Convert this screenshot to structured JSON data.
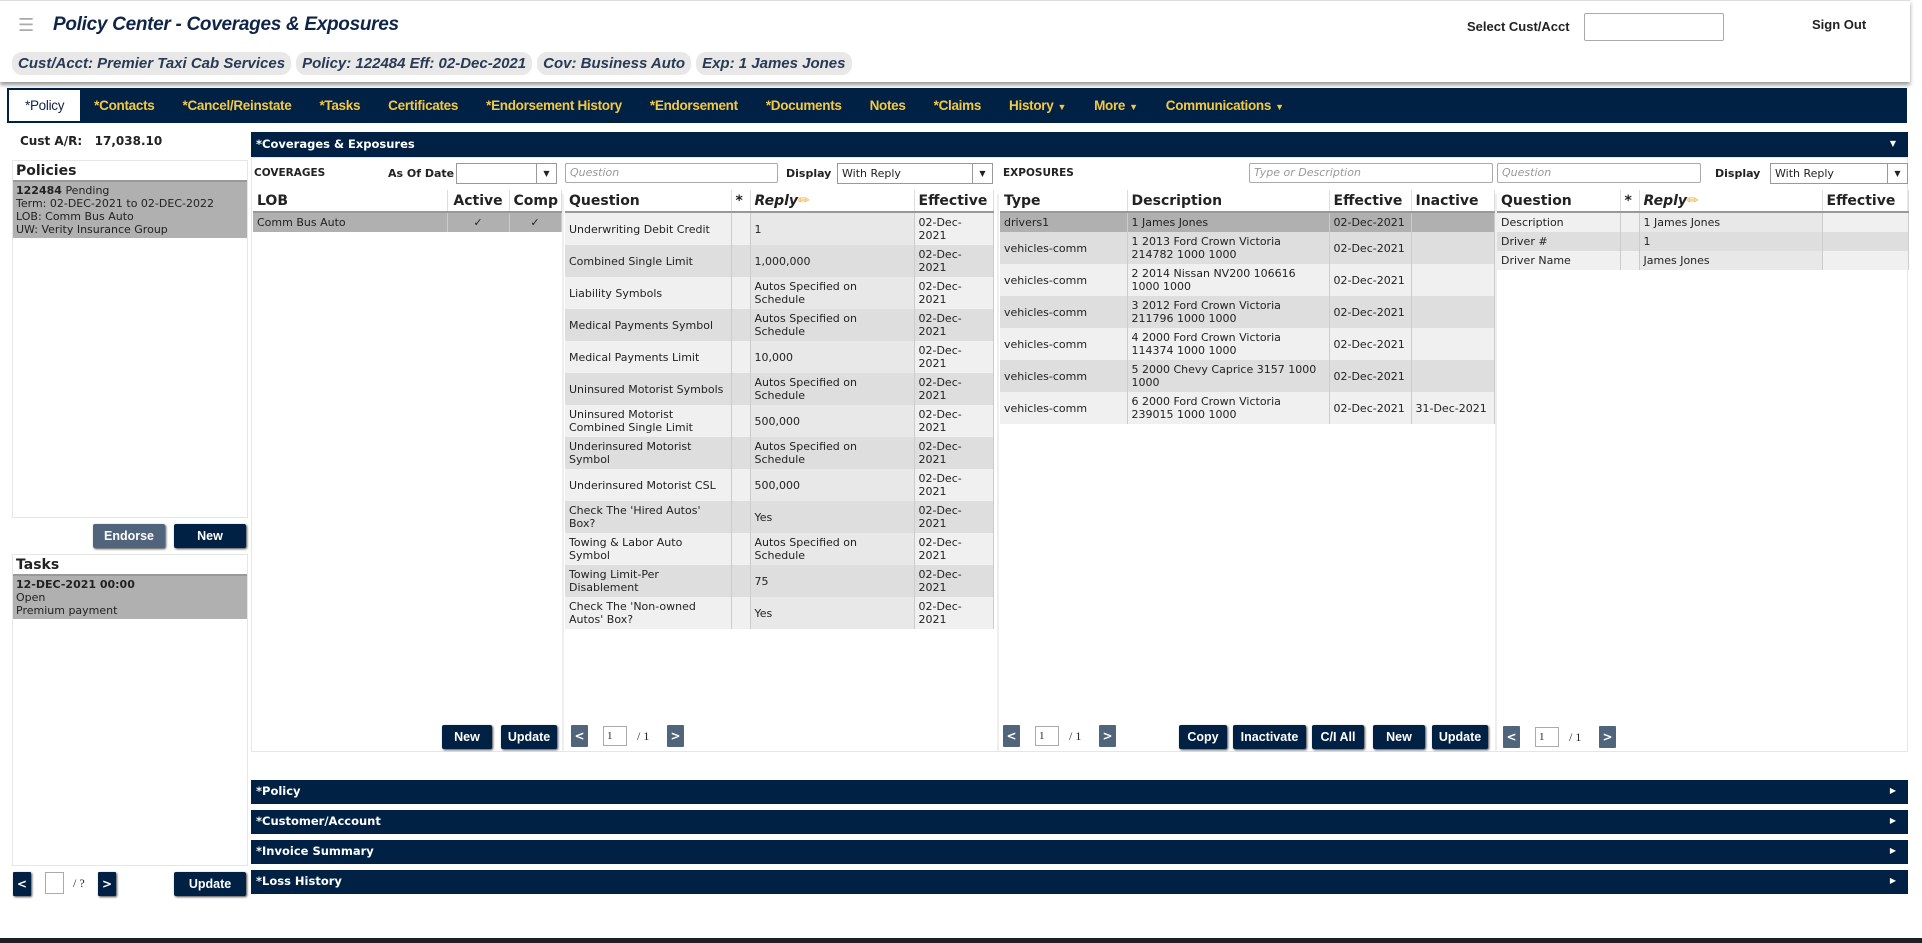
{
  "header": {
    "title": "Policy Center - Coverages & Exposures",
    "pills": [
      "Cust/Acct: Premier Taxi Cab Services",
      "Policy: 122484 Eff: 02-Dec-2021",
      "Cov: Business Auto",
      "Exp: 1 James Jones"
    ],
    "select_label": "Select Cust/Acct",
    "select_value": "",
    "sign_out": "Sign Out"
  },
  "nav": [
    {
      "label": "*Policy",
      "active": true
    },
    {
      "label": "*Contacts"
    },
    {
      "label": "*Cancel/Reinstate"
    },
    {
      "label": "*Tasks"
    },
    {
      "label": "Certificates"
    },
    {
      "label": "*Endorsement History"
    },
    {
      "label": "*Endorsement"
    },
    {
      "label": "*Documents"
    },
    {
      "label": "Notes"
    },
    {
      "label": "*Claims"
    },
    {
      "label": "History",
      "dropdown": true
    },
    {
      "label": "More",
      "dropdown": true
    },
    {
      "label": "Communications",
      "dropdown": true
    }
  ],
  "sidebar": {
    "ar_label": "Cust A/R:",
    "ar_value": "17,038.10",
    "policies": {
      "title": "Policies",
      "item": {
        "number": "122484",
        "status": "Pending",
        "term": "Term: 02-DEC-2021 to 02-DEC-2022",
        "lob": "LOB: Comm Bus Auto",
        "uw": "UW: Verity Insurance Group"
      },
      "endorse": "Endorse",
      "new": "New"
    },
    "tasks": {
      "title": "Tasks",
      "item": {
        "date": "12-DEC-2021 00:00",
        "status": "Open",
        "desc": "Premium payment"
      }
    },
    "pager": {
      "page": "",
      "total": "/ ?",
      "prev": "<",
      "next": ">"
    },
    "update": "Update"
  },
  "main": {
    "title": "*Coverages & Exposures",
    "coverages": {
      "label": "COVERAGES",
      "as_of_label": "As Of Date",
      "as_of_value": "",
      "question_placeholder": "Question",
      "display_label": "Display",
      "display_value": "With Reply",
      "lob_headers": [
        "LOB",
        "Active",
        "Comp"
      ],
      "lob_rows": [
        [
          "Comm Bus Auto",
          "✓",
          "✓"
        ]
      ],
      "q_headers": [
        "Question",
        "*",
        "Reply",
        "Effective"
      ],
      "q_rows": [
        [
          "Underwriting Debit Credit",
          "",
          "1",
          "02-Dec-2021"
        ],
        [
          "Combined Single Limit",
          "",
          "1,000,000",
          "02-Dec-2021"
        ],
        [
          "Liability Symbols",
          "",
          "Autos Specified on Schedule",
          "02-Dec-2021"
        ],
        [
          "Medical Payments Symbol",
          "",
          "Autos Specified on Schedule",
          "02-Dec-2021"
        ],
        [
          "Medical Payments Limit",
          "",
          "10,000",
          "02-Dec-2021"
        ],
        [
          "Uninsured Motorist Symbols",
          "",
          "Autos Specified on Schedule",
          "02-Dec-2021"
        ],
        [
          "Uninsured Motorist Combined Single Limit",
          "",
          "500,000",
          "02-Dec-2021"
        ],
        [
          "Underinsured Motorist Symbol",
          "",
          "Autos Specified on Schedule",
          "02-Dec-2021"
        ],
        [
          "Underinsured Motorist CSL",
          "",
          "500,000",
          "02-Dec-2021"
        ],
        [
          "Check The 'Hired Autos' Box?",
          "",
          "Yes",
          "02-Dec-2021"
        ],
        [
          "Towing & Labor Auto Symbol",
          "",
          "Autos Specified on Schedule",
          "02-Dec-2021"
        ],
        [
          "Towing Limit-Per Disablement",
          "",
          "75",
          "02-Dec-2021"
        ],
        [
          "Check The 'Non-owned Autos' Box?",
          "",
          "Yes",
          "02-Dec-2021"
        ]
      ],
      "new": "New",
      "update": "Update",
      "pager": {
        "page": "1",
        "total": "/ 1",
        "prev": "<",
        "next": ">"
      }
    },
    "exposures": {
      "label": "EXPOSURES",
      "search_placeholder": "Type or Description",
      "headers": [
        "Type",
        "Description",
        "Effective",
        "Inactive"
      ],
      "rows": [
        [
          "drivers1",
          "1 James Jones",
          "02-Dec-2021",
          ""
        ],
        [
          "vehicles-comm",
          "1 2013 Ford Crown Victoria 214782 1000 1000",
          "02-Dec-2021",
          ""
        ],
        [
          "vehicles-comm",
          "2 2014 Nissan NV200 106616 1000 1000",
          "02-Dec-2021",
          ""
        ],
        [
          "vehicles-comm",
          "3 2012 Ford Crown Victoria 211796 1000 1000",
          "02-Dec-2021",
          ""
        ],
        [
          "vehicles-comm",
          "4 2000 Ford Crown Victoria 114374 1000 1000",
          "02-Dec-2021",
          ""
        ],
        [
          "vehicles-comm",
          "5 2000 Chevy Caprice 3157 1000 1000",
          "02-Dec-2021",
          ""
        ],
        [
          "vehicles-comm",
          "6 2000 Ford Crown Victoria 239015 1000 1000",
          "02-Dec-2021",
          "31-Dec-2021"
        ]
      ],
      "copy": "Copy",
      "inactivate": "Inactivate",
      "ci_all": "C/I All",
      "new": "New",
      "update": "Update",
      "pager": {
        "page": "1",
        "total": "/ 1",
        "prev": "<",
        "next": ">"
      }
    },
    "exp_questions": {
      "question_placeholder": "Question",
      "display_label": "Display",
      "display_value": "With Reply",
      "headers": [
        "Question",
        "*",
        "Reply",
        "Effective"
      ],
      "rows": [
        [
          "Description",
          "",
          "1 James Jones",
          ""
        ],
        [
          "Driver #",
          "",
          "1",
          ""
        ],
        [
          "Driver Name",
          "",
          "James Jones",
          ""
        ]
      ],
      "pager": {
        "page": "1",
        "total": "/ 1",
        "prev": "<",
        "next": ">"
      }
    }
  },
  "sections": [
    "*Policy",
    "*Customer/Account",
    "*Invoice Summary",
    "*Loss History"
  ]
}
